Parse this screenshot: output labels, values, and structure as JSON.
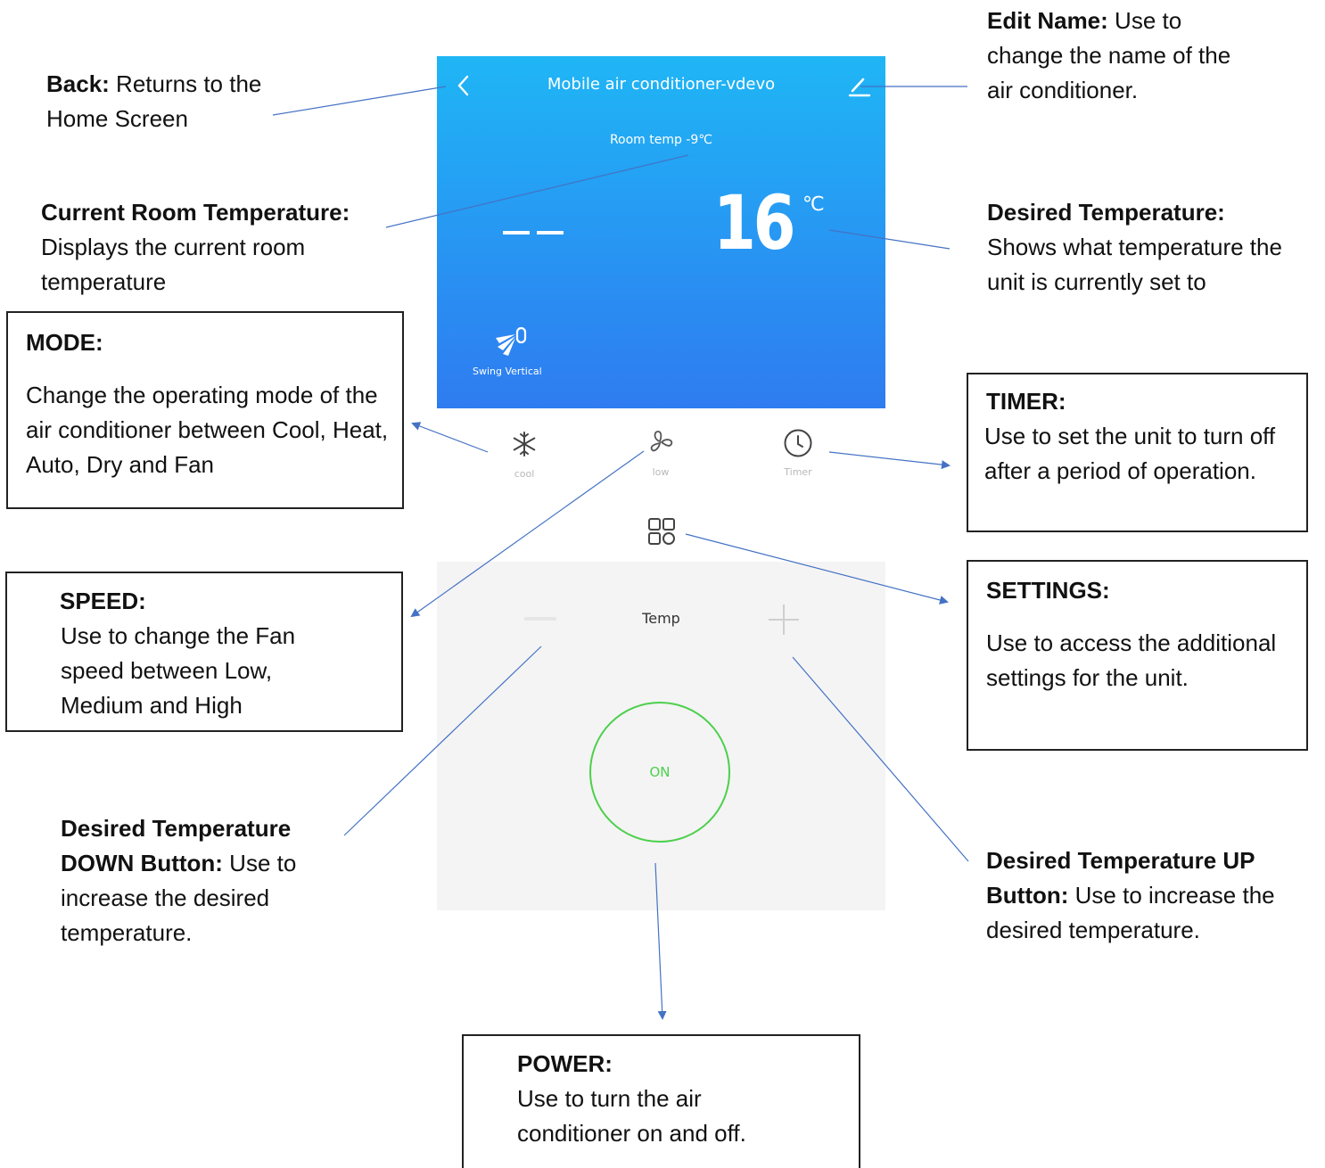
{
  "app": {
    "title": "Mobile air conditioner-vdevo",
    "room_temp": "Room temp -9℃",
    "current_display": "——",
    "set_temp": "16",
    "unit": "℃",
    "swing_label": "Swing Vertical",
    "mode_label": "cool",
    "speed_label": "low",
    "timer_label": "Timer",
    "temp_label": "Temp",
    "power_label": "ON",
    "colors": {
      "top_start": "#1fb6f5",
      "top_end": "#2f7cf0",
      "power": "#4cd04c",
      "arrow": "#4472c4"
    }
  },
  "annotations": {
    "back": {
      "title": "Back:",
      "text": " Returns to the Home Screen"
    },
    "edit_name": {
      "title": "Edit Name:",
      "text": " Use to change the name of the air conditioner."
    },
    "room_temp": {
      "title": "Current Room Temperature:",
      "text": " Displays the current room temperature"
    },
    "desired_temp": {
      "title": "Desired Temperature:",
      "text": "Shows what temperature the unit is currently set to"
    },
    "mode": {
      "title": "MODE:",
      "text": "Change the operating mode of the air conditioner between Cool, Heat, Auto, Dry and Fan"
    },
    "timer": {
      "title": "TIMER:",
      "text": "Use to set the unit to turn off after a period of operation."
    },
    "speed": {
      "title": "SPEED:",
      "text": "Use to change the Fan speed between Low, Medium and High"
    },
    "settings": {
      "title": "SETTINGS:",
      "text": "Use to access the additional settings for the unit."
    },
    "temp_down": {
      "title": "Desired Temperature DOWN Button:",
      "text": " Use to increase the desired temperature."
    },
    "temp_up": {
      "title": "Desired Temperature UP Button:",
      "text": " Use to increase the desired temperature."
    },
    "power": {
      "title": "POWER:",
      "text": "Use to turn the air conditioner on and off."
    }
  }
}
